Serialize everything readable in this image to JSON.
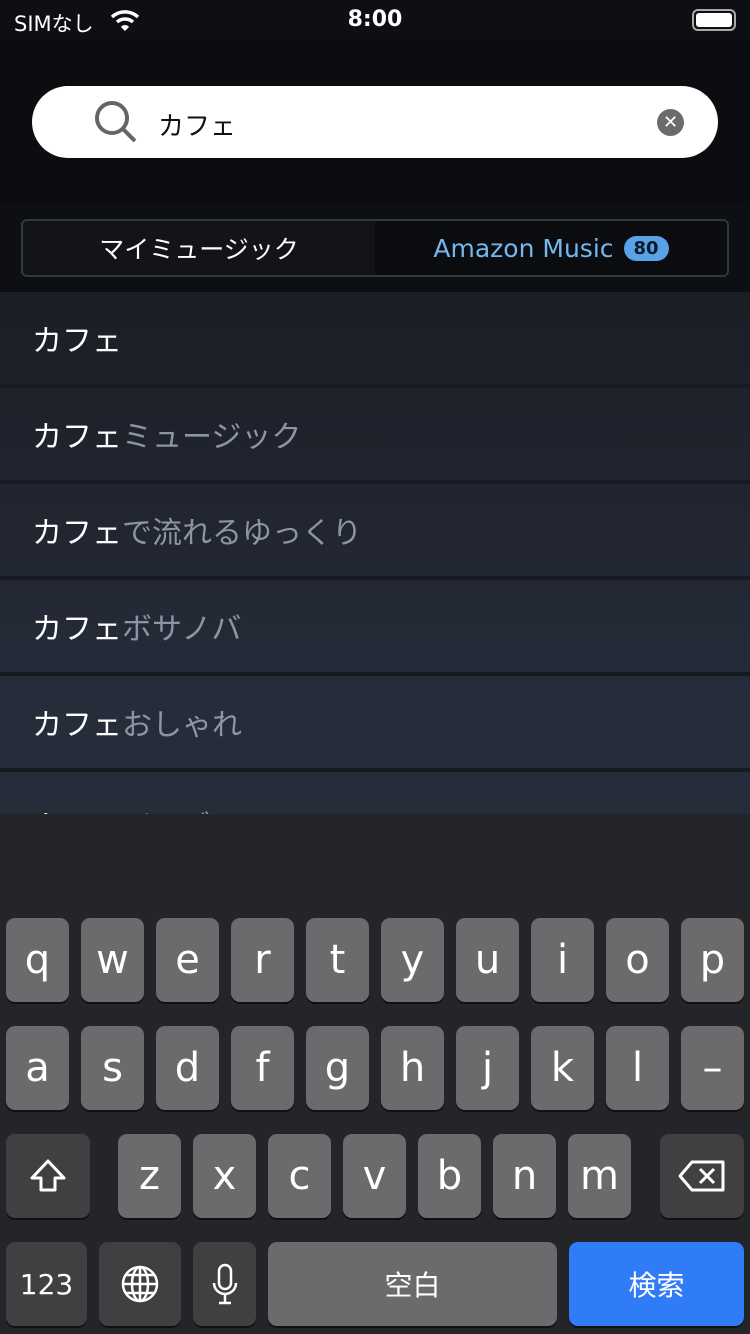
{
  "status": {
    "carrier": "SIMなし",
    "time": "8:00"
  },
  "search": {
    "value": "カフェ"
  },
  "tabs": [
    {
      "label": "マイミュージック"
    },
    {
      "label": "Amazon Music",
      "badge": "80"
    }
  ],
  "suggestions": [
    {
      "match": "カフェ",
      "rest": ""
    },
    {
      "match": "カフェ",
      "rest": "ミュージック"
    },
    {
      "match": "カフェ",
      "rest": "で流れるゆっくり"
    },
    {
      "match": "カフェ",
      "rest": " ボサノバ"
    },
    {
      "match": "カフェ",
      "rest": " おしゃれ"
    },
    {
      "match": "カフェ",
      "rest": " ジャズ"
    }
  ],
  "keyboard": {
    "row1": [
      "q",
      "w",
      "e",
      "r",
      "t",
      "y",
      "u",
      "i",
      "o",
      "p"
    ],
    "row2": [
      "a",
      "s",
      "d",
      "f",
      "g",
      "h",
      "j",
      "k",
      "l",
      "–"
    ],
    "row3": [
      "z",
      "x",
      "c",
      "v",
      "b",
      "n",
      "m"
    ],
    "numbers": "123",
    "space": "空白",
    "search": "検索"
  },
  "colors": {
    "accent": "#74b8ee",
    "search_key": "#2f7cf6"
  }
}
